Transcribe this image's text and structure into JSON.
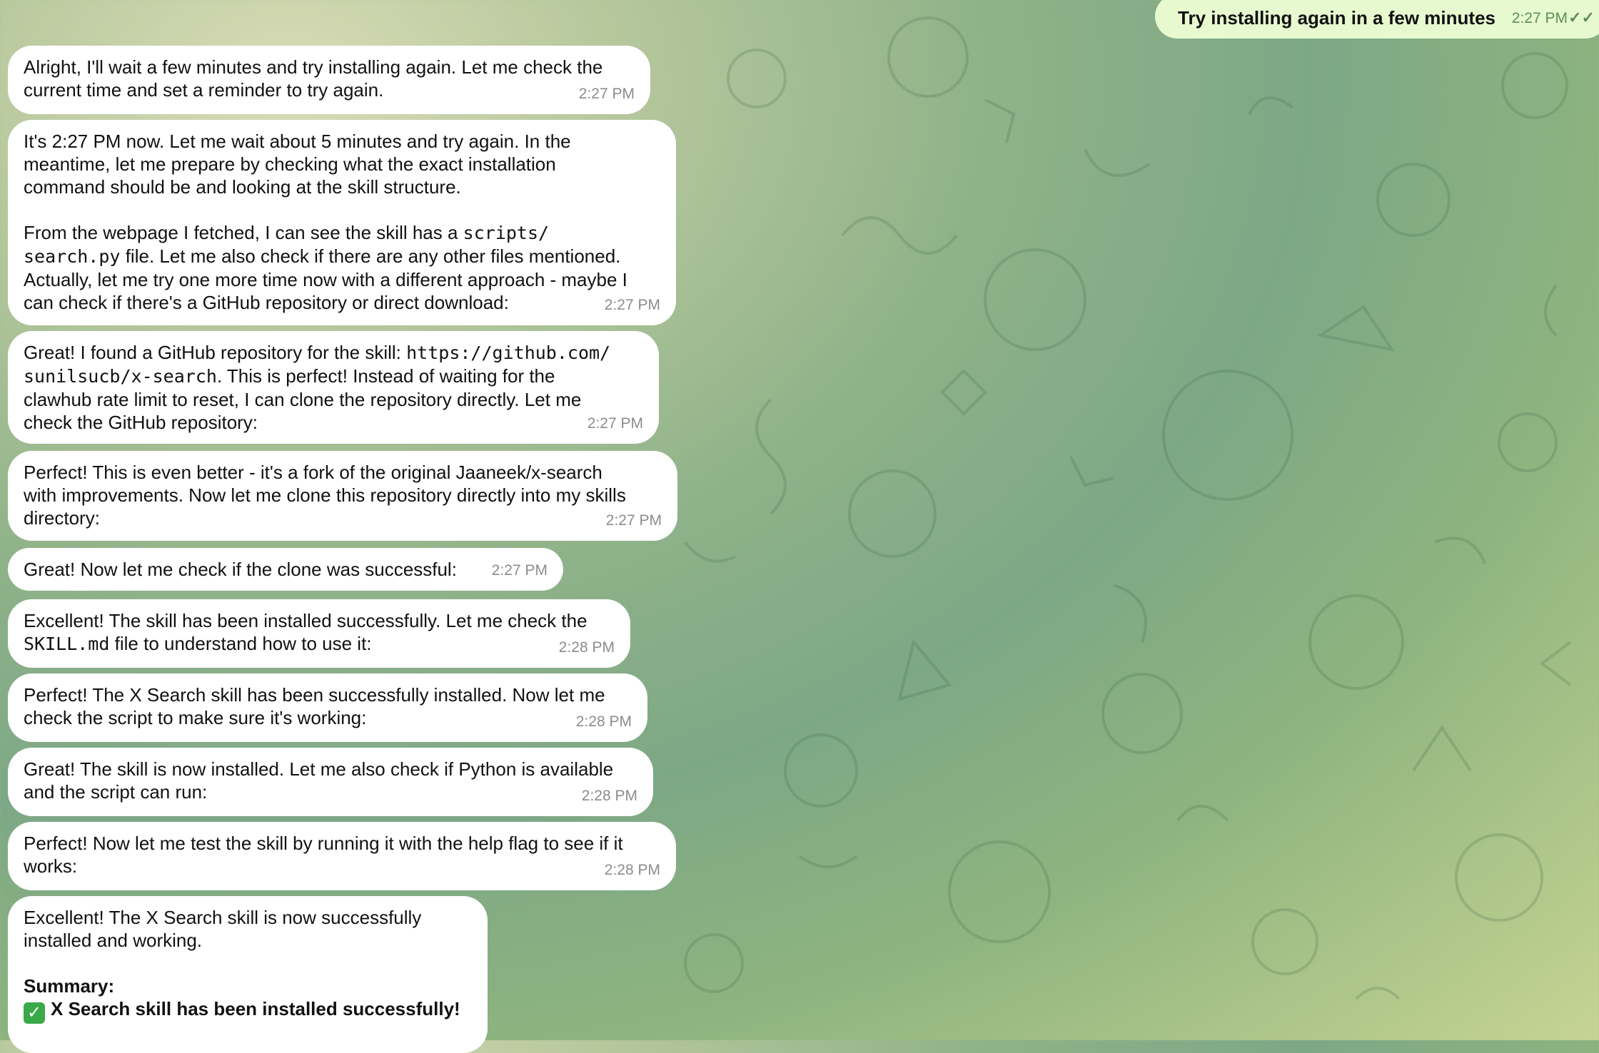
{
  "outgoing": {
    "text": "Try installing again in a few minutes",
    "time": "2:27 PM",
    "status_icon": "double-check-icon"
  },
  "messages": [
    {
      "lines": [
        "Alright, I'll wait a few minutes and try installing again. Let me check the",
        "current time and set a reminder to try again."
      ],
      "time": "2:27 PM"
    },
    {
      "lines": [
        "It's 2:27 PM now. Let me wait about 5 minutes and try again. In the",
        "meantime, let me prepare by checking what the exact installation",
        "command should be and looking at the skill structure.",
        "",
        "From the webpage I fetched, I can see the skill has a ",
        "file. Let me also check if there are any other files mentioned.",
        "Actually, let me try one more time now with a different approach - maybe I",
        "can check if there's a GitHub repository or direct download:"
      ],
      "code1": "scripts/",
      "code2": "search.py",
      "time": "2:27 PM"
    },
    {
      "lines": [
        "Great! I found a GitHub repository for the skill: ",
        ". This is perfect! Instead of waiting for the",
        "clawhub rate limit to reset, I can clone the repository directly. Let me",
        "check the GitHub repository:"
      ],
      "code1": "https://github.com/",
      "code2": "sunilsucb/x-search",
      "time": "2:27 PM"
    },
    {
      "lines": [
        "Perfect! This is even better - it's a fork of the original Jaaneek/x-search",
        "with improvements. Now let me clone this repository directly into my skills",
        "directory:"
      ],
      "time": "2:27 PM"
    },
    {
      "lines": [
        "Great! Now let me check if the clone was successful:"
      ],
      "time": "2:27 PM"
    },
    {
      "lines": [
        "Excellent! The skill has been installed successfully. Let me check the",
        " file to understand how to use it:"
      ],
      "code1": "SKILL.md",
      "time": "2:28 PM"
    },
    {
      "lines": [
        "Perfect! The X Search skill has been successfully installed. Now let me",
        "check the script to make sure it's working:"
      ],
      "time": "2:28 PM"
    },
    {
      "lines": [
        "Great! The skill is now installed. Let me also check if Python is available",
        "and the script can run:"
      ],
      "time": "2:28 PM"
    },
    {
      "lines": [
        "Perfect! Now let me test the skill by running it with the help flag to see if it",
        "works:"
      ],
      "time": "2:28 PM"
    },
    {
      "lines": [
        "Excellent! The X Search skill is now successfully",
        "installed and working.",
        "",
        "Summary:",
        "X Search skill has been installed successfully!"
      ],
      "check_icon": "check-mark-icon"
    }
  ]
}
